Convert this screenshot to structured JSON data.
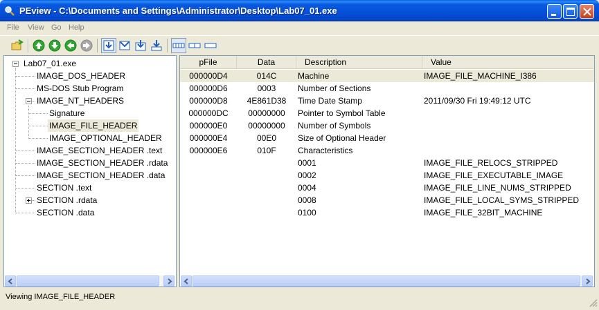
{
  "window": {
    "title": "PEview - C:\\Documents and Settings\\Administrator\\Desktop\\Lab07_01.exe"
  },
  "menu": [
    "File",
    "View",
    "Go",
    "Help"
  ],
  "toolbar_icons": [
    "open-folder-icon",
    "go-up-icon",
    "go-down-icon",
    "back-icon",
    "forward-icon",
    "view-toggle-icon",
    "view-open-icon",
    "view-down-icon",
    "view-down-alt-icon",
    "view-byte-icon",
    "view-word-icon",
    "view-dword-icon"
  ],
  "tree": {
    "root": "Lab07_01.exe",
    "items": [
      {
        "label": "IMAGE_DOS_HEADER"
      },
      {
        "label": "MS-DOS Stub Program"
      },
      {
        "label": "IMAGE_NT_HEADERS"
      },
      {
        "label": "Signature"
      },
      {
        "label": "IMAGE_FILE_HEADER"
      },
      {
        "label": "IMAGE_OPTIONAL_HEADER"
      },
      {
        "label": "IMAGE_SECTION_HEADER .text"
      },
      {
        "label": "IMAGE_SECTION_HEADER .rdata"
      },
      {
        "label": "IMAGE_SECTION_HEADER .data"
      },
      {
        "label": "SECTION .text"
      },
      {
        "label": "SECTION .rdata"
      },
      {
        "label": "SECTION .data"
      }
    ]
  },
  "table": {
    "columns": [
      "pFile",
      "Data",
      "Description",
      "Value"
    ],
    "rows": [
      [
        "000000D4",
        "014C",
        "Machine",
        "IMAGE_FILE_MACHINE_I386"
      ],
      [
        "000000D6",
        "0003",
        "Number of Sections",
        ""
      ],
      [
        "000000D8",
        "4E861D38",
        "Time Date Stamp",
        "2011/09/30 Fri 19:49:12 UTC"
      ],
      [
        "000000DC",
        "00000000",
        "Pointer to Symbol Table",
        ""
      ],
      [
        "000000E0",
        "00000000",
        "Number of Symbols",
        ""
      ],
      [
        "000000E4",
        "00E0",
        "Size of Optional Header",
        ""
      ],
      [
        "000000E6",
        "010F",
        "Characteristics",
        ""
      ],
      [
        "",
        "",
        "0001",
        "IMAGE_FILE_RELOCS_STRIPPED"
      ],
      [
        "",
        "",
        "0002",
        "IMAGE_FILE_EXECUTABLE_IMAGE"
      ],
      [
        "",
        "",
        "0004",
        "IMAGE_FILE_LINE_NUMS_STRIPPED"
      ],
      [
        "",
        "",
        "0008",
        "IMAGE_FILE_LOCAL_SYMS_STRIPPED"
      ],
      [
        "",
        "",
        "0100",
        "IMAGE_FILE_32BIT_MACHINE"
      ]
    ]
  },
  "status": {
    "text": "Viewing IMAGE_FILE_HEADER"
  },
  "colors": {
    "titlebar": "#0450d8",
    "selection": "#ece9d8",
    "pane_border": "#7f9db9"
  }
}
